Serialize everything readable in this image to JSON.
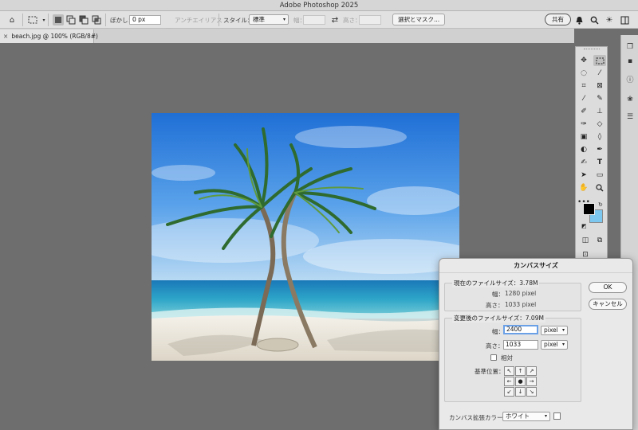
{
  "window": {
    "title": "Adobe Photoshop 2025"
  },
  "options_bar": {
    "feather_label": "ぼかし：",
    "feather_value": "0 px",
    "antialias_label": "アンチエイリアス",
    "style_label": "スタイル：",
    "style_value": "標準",
    "width_label": "幅：",
    "height_label": "高さ：",
    "select_mask_button": "選択とマスク...",
    "share_button": "共有"
  },
  "document_tab": {
    "title": "beach.jpg @ 100% (RGB/8#)",
    "close": "×"
  },
  "colors": {
    "foreground": "#000000",
    "background": "#7cc7f0",
    "accent": "#6aa0e6"
  },
  "icons": [
    "home-icon",
    "marquee-icon",
    "new-selection-icon",
    "add-selection-icon",
    "subtract-selection-icon",
    "intersect-selection-icon",
    "swap-icon",
    "bell-icon",
    "search-icon",
    "bulb-icon",
    "workspace-icon",
    "move-icon",
    "lasso-icon",
    "magic-wand-icon",
    "crop-icon",
    "frame-icon",
    "eyedropper-icon",
    "healing-icon",
    "brush-icon",
    "stamp-icon",
    "history-brush-icon",
    "eraser-icon",
    "gradient-icon",
    "blur-icon",
    "dodge-icon",
    "pen-icon",
    "type-icon",
    "path-select-icon",
    "rectangle-icon",
    "hand-icon",
    "zoom-icon",
    "more-icon",
    "learn-icon",
    "comment-icon",
    "info-icon",
    "libraries-icon",
    "adjustments-icon"
  ],
  "dialog": {
    "title": "カンバスサイズ",
    "current_size_label": "現在のファイルサイズ：3.78M",
    "current_width_label": "幅：",
    "current_width_value": "1280 pixel",
    "current_height_label": "高さ：",
    "current_height_value": "1033 pixel",
    "new_size_label": "変更後のファイルサイズ：7.09M",
    "new_width_label": "幅：",
    "new_width_value": "2400",
    "new_width_unit": "pixel",
    "new_height_label": "高さ：",
    "new_height_value": "1033",
    "new_height_unit": "pixel",
    "relative_label": "相対",
    "anchor_label": "基準位置：",
    "anchor_arrows": [
      "↖",
      "↑",
      "↗",
      "←",
      "●",
      "→",
      "↙",
      "↓",
      "↘"
    ],
    "extension_color_label": "カンバス拡張カラー：",
    "extension_color_value": "ホワイト",
    "ok_button": "OK",
    "cancel_button": "キャンセル"
  }
}
